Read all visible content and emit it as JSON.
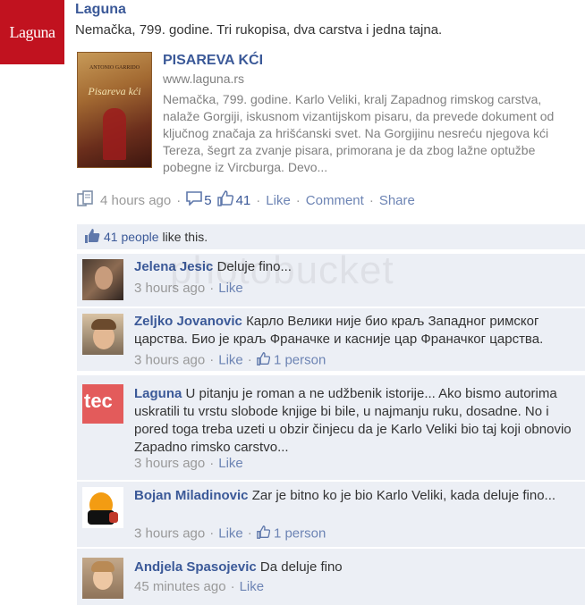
{
  "post": {
    "logo_text": "Laguna",
    "author": "Laguna",
    "message": "Nemačka, 799. godine. Tri rukopisa, dva carstva i jedna tajna.",
    "attachment": {
      "thumb_top": "ANTONIO GARRIDO",
      "thumb_title": "Pisareva kći",
      "title": "PISAREVA KĆI",
      "url": "www.laguna.rs",
      "description": "Nemačka, 799. godine. Karlo Veliki, kralj Zapadnog rimskog carstva, nalaže Gorgiji, iskusnom vizantijskom pisaru, da prevede dokument od ključnog značaja za hrišćanski svet. Na Gorgijinu nesreću njegova kći Tereza, šegrt za zvanje pisara, primorana je da zbog lažne optužbe pobegne iz Vircburga. Devo..."
    },
    "time": "4 hours ago",
    "comment_count": "5",
    "like_count": "41",
    "like_label": "Like",
    "comment_label": "Comment",
    "share_label": "Share"
  },
  "likes_box": {
    "people": "41 people",
    "text": "like this."
  },
  "watermark": "photobucket",
  "comments": [
    {
      "name": "Jelena Jesic",
      "text": "Deluje fino...",
      "time": "3 hours ago",
      "like": "Like"
    },
    {
      "name": "Zeljko Jovanovic",
      "text": "Карло Велики није био краљ Западног римског царства. Био је краљ Франачке и касније цар Франачког царства.",
      "time": "3 hours ago",
      "like": "Like",
      "likes": "1 person"
    },
    {
      "name": "Laguna",
      "text": "U pitanju je roman a ne udžbenik istorije... Ako bismo autorima uskratili tu vrstu slobode knjige bi bile, u najmanju ruku, dosadne. No i pored toga treba uzeti u obzir činjecu da je Karlo Veliki bio taj koji obnovio Zapadno rimsko carstvo...",
      "time": "3 hours ago",
      "like": "Like",
      "avatar_text": "tec"
    },
    {
      "name": "Bojan Miladinovic",
      "text": "Zar je bitno ko je bio Karlo Veliki, kada deluje fino...",
      "time": "3 hours ago",
      "like": "Like",
      "likes": "1 person"
    },
    {
      "name": "Andjela Spasojevic",
      "text": "Da deluje fino",
      "time": "45 minutes ago",
      "like": "Like"
    }
  ]
}
